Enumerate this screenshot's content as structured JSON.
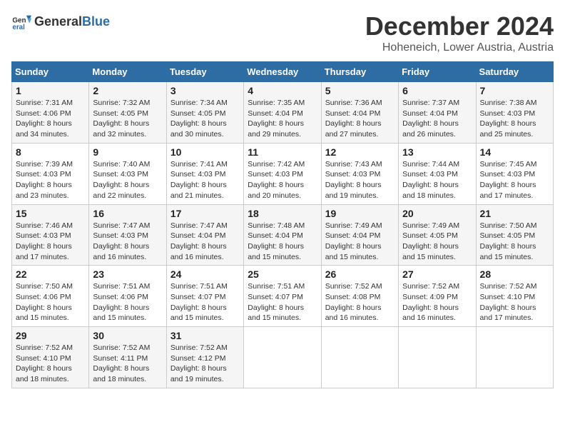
{
  "header": {
    "logo_general": "General",
    "logo_blue": "Blue",
    "title": "December 2024",
    "subtitle": "Hoheneich, Lower Austria, Austria"
  },
  "columns": [
    "Sunday",
    "Monday",
    "Tuesday",
    "Wednesday",
    "Thursday",
    "Friday",
    "Saturday"
  ],
  "weeks": [
    [
      {
        "day": "1",
        "sunrise": "7:31 AM",
        "sunset": "4:06 PM",
        "daylight": "8 hours and 34 minutes."
      },
      {
        "day": "2",
        "sunrise": "7:32 AM",
        "sunset": "4:05 PM",
        "daylight": "8 hours and 32 minutes."
      },
      {
        "day": "3",
        "sunrise": "7:34 AM",
        "sunset": "4:05 PM",
        "daylight": "8 hours and 30 minutes."
      },
      {
        "day": "4",
        "sunrise": "7:35 AM",
        "sunset": "4:04 PM",
        "daylight": "8 hours and 29 minutes."
      },
      {
        "day": "5",
        "sunrise": "7:36 AM",
        "sunset": "4:04 PM",
        "daylight": "8 hours and 27 minutes."
      },
      {
        "day": "6",
        "sunrise": "7:37 AM",
        "sunset": "4:04 PM",
        "daylight": "8 hours and 26 minutes."
      },
      {
        "day": "7",
        "sunrise": "7:38 AM",
        "sunset": "4:03 PM",
        "daylight": "8 hours and 25 minutes."
      }
    ],
    [
      {
        "day": "8",
        "sunrise": "7:39 AM",
        "sunset": "4:03 PM",
        "daylight": "8 hours and 23 minutes."
      },
      {
        "day": "9",
        "sunrise": "7:40 AM",
        "sunset": "4:03 PM",
        "daylight": "8 hours and 22 minutes."
      },
      {
        "day": "10",
        "sunrise": "7:41 AM",
        "sunset": "4:03 PM",
        "daylight": "8 hours and 21 minutes."
      },
      {
        "day": "11",
        "sunrise": "7:42 AM",
        "sunset": "4:03 PM",
        "daylight": "8 hours and 20 minutes."
      },
      {
        "day": "12",
        "sunrise": "7:43 AM",
        "sunset": "4:03 PM",
        "daylight": "8 hours and 19 minutes."
      },
      {
        "day": "13",
        "sunrise": "7:44 AM",
        "sunset": "4:03 PM",
        "daylight": "8 hours and 18 minutes."
      },
      {
        "day": "14",
        "sunrise": "7:45 AM",
        "sunset": "4:03 PM",
        "daylight": "8 hours and 17 minutes."
      }
    ],
    [
      {
        "day": "15",
        "sunrise": "7:46 AM",
        "sunset": "4:03 PM",
        "daylight": "8 hours and 17 minutes."
      },
      {
        "day": "16",
        "sunrise": "7:47 AM",
        "sunset": "4:03 PM",
        "daylight": "8 hours and 16 minutes."
      },
      {
        "day": "17",
        "sunrise": "7:47 AM",
        "sunset": "4:04 PM",
        "daylight": "8 hours and 16 minutes."
      },
      {
        "day": "18",
        "sunrise": "7:48 AM",
        "sunset": "4:04 PM",
        "daylight": "8 hours and 15 minutes."
      },
      {
        "day": "19",
        "sunrise": "7:49 AM",
        "sunset": "4:04 PM",
        "daylight": "8 hours and 15 minutes."
      },
      {
        "day": "20",
        "sunrise": "7:49 AM",
        "sunset": "4:05 PM",
        "daylight": "8 hours and 15 minutes."
      },
      {
        "day": "21",
        "sunrise": "7:50 AM",
        "sunset": "4:05 PM",
        "daylight": "8 hours and 15 minutes."
      }
    ],
    [
      {
        "day": "22",
        "sunrise": "7:50 AM",
        "sunset": "4:06 PM",
        "daylight": "8 hours and 15 minutes."
      },
      {
        "day": "23",
        "sunrise": "7:51 AM",
        "sunset": "4:06 PM",
        "daylight": "8 hours and 15 minutes."
      },
      {
        "day": "24",
        "sunrise": "7:51 AM",
        "sunset": "4:07 PM",
        "daylight": "8 hours and 15 minutes."
      },
      {
        "day": "25",
        "sunrise": "7:51 AM",
        "sunset": "4:07 PM",
        "daylight": "8 hours and 15 minutes."
      },
      {
        "day": "26",
        "sunrise": "7:52 AM",
        "sunset": "4:08 PM",
        "daylight": "8 hours and 16 minutes."
      },
      {
        "day": "27",
        "sunrise": "7:52 AM",
        "sunset": "4:09 PM",
        "daylight": "8 hours and 16 minutes."
      },
      {
        "day": "28",
        "sunrise": "7:52 AM",
        "sunset": "4:10 PM",
        "daylight": "8 hours and 17 minutes."
      }
    ],
    [
      {
        "day": "29",
        "sunrise": "7:52 AM",
        "sunset": "4:10 PM",
        "daylight": "8 hours and 18 minutes."
      },
      {
        "day": "30",
        "sunrise": "7:52 AM",
        "sunset": "4:11 PM",
        "daylight": "8 hours and 18 minutes."
      },
      {
        "day": "31",
        "sunrise": "7:52 AM",
        "sunset": "4:12 PM",
        "daylight": "8 hours and 19 minutes."
      },
      null,
      null,
      null,
      null
    ]
  ],
  "labels": {
    "sunrise": "Sunrise:",
    "sunset": "Sunset:",
    "daylight": "Daylight:"
  }
}
